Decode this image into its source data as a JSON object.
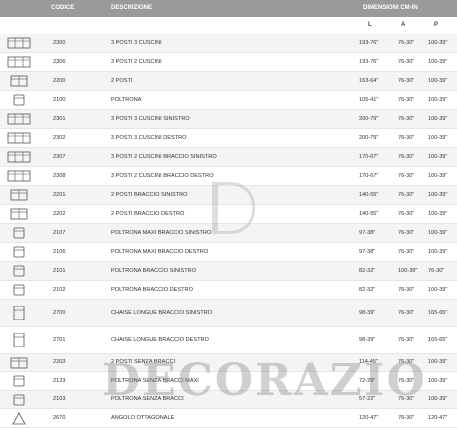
{
  "header": {
    "codice": "CODICE",
    "descrizione": "DESCRIZIONE",
    "dimensioni": "DIMENSIONI CM-IN",
    "l": "L",
    "a": "A",
    "p": "P"
  },
  "rows": [
    {
      "icon": "sofa-3-icon",
      "code": "2300",
      "desc": "3 POSTI 3 CUSCINI",
      "l": "193-76\"",
      "a": "76-30\"",
      "p": "100-39\""
    },
    {
      "icon": "sofa-3-icon",
      "code": "2306",
      "desc": "3 POSTI 2 CUSCINI",
      "l": "193-76\"",
      "a": "76-30\"",
      "p": "100-39\""
    },
    {
      "icon": "sofa-2-icon",
      "code": "2200",
      "desc": "2 POSTI",
      "l": "163-64\"",
      "a": "76-30\"",
      "p": "100-39\""
    },
    {
      "icon": "armchair-icon",
      "code": "2100",
      "desc": "POLTRONA",
      "l": "105-41\"",
      "a": "76-30\"",
      "p": "100-39\""
    },
    {
      "icon": "sofa-3-left-icon",
      "code": "2301",
      "desc": "3 POSTI 3 CUSCINI SINISTRO",
      "l": "200-79\"",
      "a": "76-30\"",
      "p": "100-39\""
    },
    {
      "icon": "sofa-3-right-icon",
      "code": "2302",
      "desc": "3 POSTI 3 CUSCINI DESTRO",
      "l": "200-79\"",
      "a": "76-30\"",
      "p": "100-39\""
    },
    {
      "icon": "sofa-3-left-icon",
      "code": "2307",
      "desc": "3 POSTI 2 CUSCINI BRACCIO SINISTRO",
      "l": "170-67\"",
      "a": "76-30\"",
      "p": "100-39\""
    },
    {
      "icon": "sofa-3-right-icon",
      "code": "2308",
      "desc": "3 POSTI 2 CUSCINI BRACCIO DESTRO",
      "l": "170-67\"",
      "a": "76-30\"",
      "p": "100-39\""
    },
    {
      "icon": "sofa-2-left-icon",
      "code": "2201",
      "desc": "2 POSTI BRACCIO SINISTRO",
      "l": "140-55\"",
      "a": "76-30\"",
      "p": "100-39\""
    },
    {
      "icon": "sofa-2-right-icon",
      "code": "2202",
      "desc": "2 POSTI BRACCIO DESTRO",
      "l": "140-55\"",
      "a": "76-30\"",
      "p": "100-39\""
    },
    {
      "icon": "armchair-left-icon",
      "code": "2107",
      "desc": "POLTRONA MAXI BRACCIO SINISTRO",
      "l": "97-38\"",
      "a": "76-30\"",
      "p": "100-39\""
    },
    {
      "icon": "armchair-right-icon",
      "code": "2106",
      "desc": "POLTRONA MAXI BRACCIO DESTRO",
      "l": "97-38\"",
      "a": "76-30\"",
      "p": "100-39\""
    },
    {
      "icon": "armchair-left-icon",
      "code": "2101",
      "desc": "POLTRONA BRACCIO SINISTRO",
      "l": "82-32\"",
      "a": "100-39\"",
      "p": "76-30\""
    },
    {
      "icon": "armchair-right-icon",
      "code": "2102",
      "desc": "POLTRONA BRACCIO DESTRO",
      "l": "82-32\"",
      "a": "76-30\"",
      "p": "100-39\""
    },
    {
      "icon": "chaise-left-icon",
      "code": "2700",
      "desc": "CHAISE LONGUE BRACCIO SINISTRO",
      "l": "98-39\"",
      "a": "76-30\"",
      "p": "165-65\""
    },
    {
      "icon": "chaise-right-icon",
      "code": "2701",
      "desc": "CHAISE LONGUE BRACCIO DESTRO",
      "l": "98-39\"",
      "a": "76-30\"",
      "p": "165-65\""
    },
    {
      "icon": "sofa-2-armless-icon",
      "code": "2203",
      "desc": "2 POSTI SENZA BRACCI",
      "l": "114-45\"",
      "a": "76-30\"",
      "p": "100-39\""
    },
    {
      "icon": "armless-chair-maxi-icon",
      "code": "2123",
      "desc": "POLTRONA SENZA BRACCI MAXI",
      "l": "72-28\"",
      "a": "76-30\"",
      "p": "100-39\""
    },
    {
      "icon": "armless-chair-icon",
      "code": "2103",
      "desc": "POLTRONA SENZA BRACCI",
      "l": "57-22\"",
      "a": "76-30\"",
      "p": "100-39\""
    },
    {
      "icon": "corner-icon",
      "code": "2670",
      "desc": "ANGOLO OTTAGONALE",
      "l": "120-47\"",
      "a": "76-30\"",
      "p": "120-47\""
    }
  ],
  "watermark": "DECORAZIO"
}
